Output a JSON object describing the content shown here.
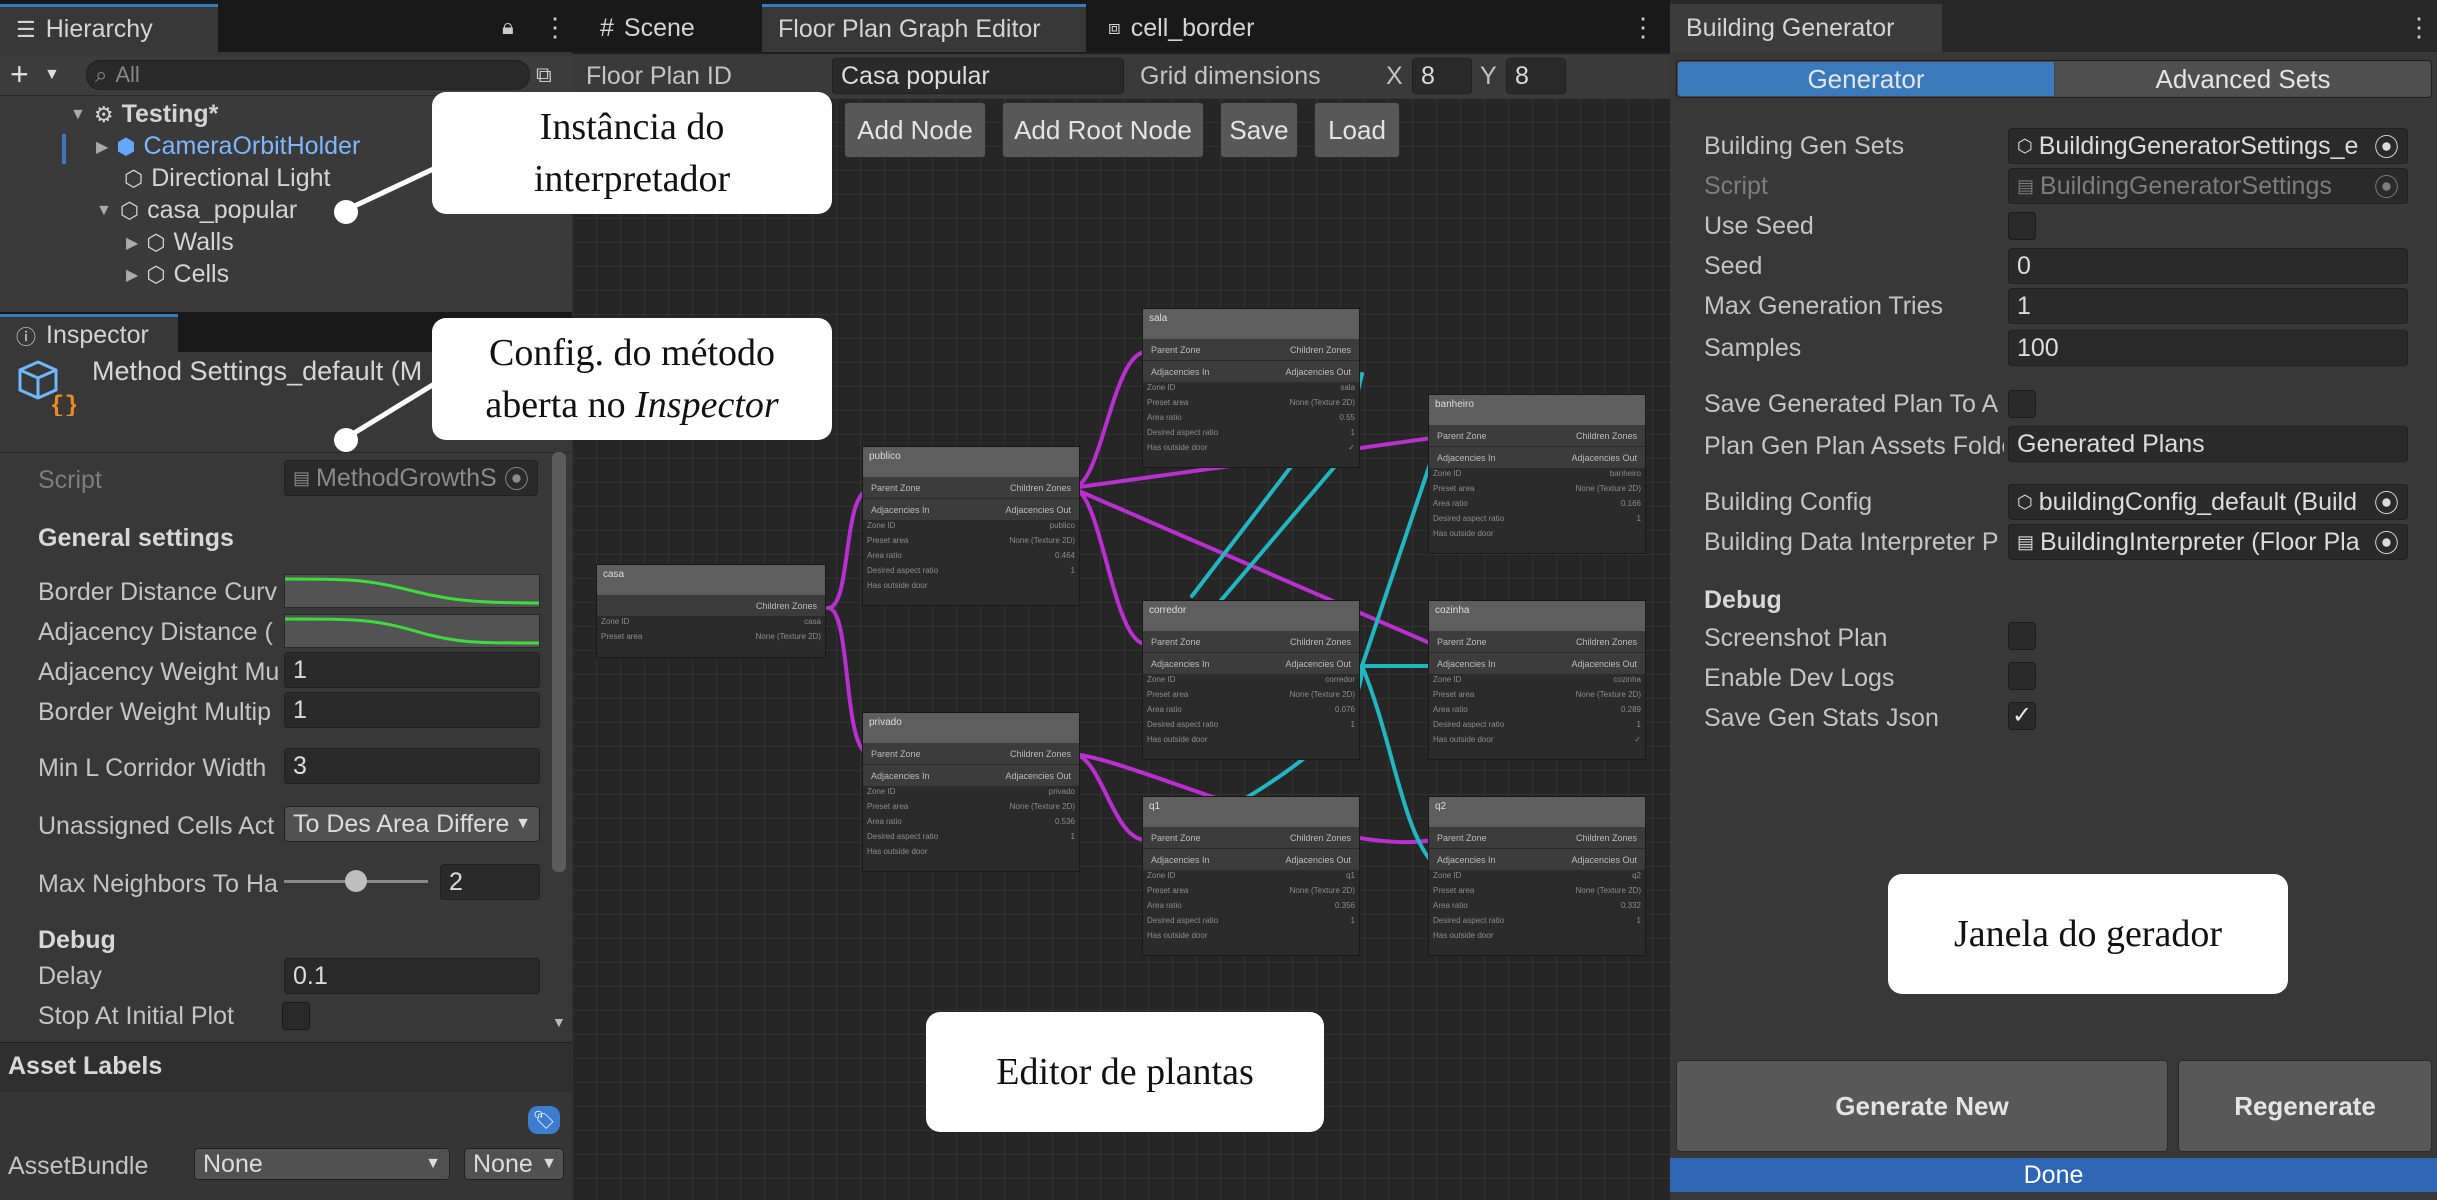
{
  "hierarchy": {
    "tab_label": "Hierarchy",
    "search_placeholder": "All",
    "items": [
      {
        "label": "Testing*"
      },
      {
        "label": "CameraOrbitHolder"
      },
      {
        "label": "Directional Light"
      },
      {
        "label": "casa_popular"
      },
      {
        "label": "Walls"
      },
      {
        "label": "Cells"
      }
    ]
  },
  "inspector": {
    "tab_label": "Inspector",
    "object_title": "Method Settings_default (M",
    "script_label": "Script",
    "script_value": "MethodGrowthS",
    "general_header": "General settings",
    "border_curve_label": "Border Distance Curv",
    "adjacency_curve_label": "Adjacency Distance (",
    "adj_weight_label": "Adjacency Weight Mu",
    "adj_weight_value": "1",
    "border_weight_label": "Border Weight Multip",
    "border_weight_value": "1",
    "min_corridor_label": "Min L Corridor Width",
    "min_corridor_value": "3",
    "unassigned_label": "Unassigned Cells Act",
    "unassigned_value": "To Des Area Differe",
    "max_neighbors_label": "Max Neighbors To Ha",
    "max_neighbors_value": "2",
    "max_neighbors_fraction": 0.5,
    "debug_header": "Debug",
    "delay_label": "Delay",
    "delay_value": "0.1",
    "stop_label": "Stop At Initial Plot",
    "asset_labels": "Asset Labels",
    "assetbundle_label": "AssetBundle",
    "assetbundle_value": "None",
    "assetbundle_variant": "None"
  },
  "center": {
    "tabs": [
      "Scene",
      "Floor Plan Graph Editor",
      "cell_border"
    ],
    "floor_plan_id_label": "Floor Plan ID",
    "floor_plan_id_value": "Casa popular",
    "grid_label": "Grid dimensions",
    "x_label": "X",
    "x_value": "8",
    "y_label": "Y",
    "y_value": "8",
    "buttons": [
      "Add Node",
      "Add Root Node",
      "Save",
      "Load"
    ]
  },
  "graph": {
    "nodes": [
      {
        "title": "casa",
        "zone_id": "casa",
        "kind": "root"
      },
      {
        "title": "publico",
        "zone_id": "publico",
        "area": "0.464",
        "aspect": "1"
      },
      {
        "title": "privado",
        "zone_id": "privado",
        "area": "0.536",
        "aspect": "1"
      },
      {
        "title": "sala",
        "zone_id": "sala",
        "area": "0.55",
        "aspect": "1"
      },
      {
        "title": "corredor",
        "zone_id": "corredor",
        "area": "0.076",
        "aspect": "1"
      },
      {
        "title": "q1",
        "zone_id": "q1",
        "area": "0.356",
        "aspect": "1"
      },
      {
        "title": "banheiro",
        "zone_id": "banheiro",
        "area": "0.166",
        "aspect": "1"
      },
      {
        "title": "cozinha",
        "zone_id": "cozinha",
        "area": "0.289",
        "aspect": "1"
      },
      {
        "title": "q2",
        "zone_id": "q2",
        "area": "0.332",
        "aspect": "1"
      }
    ],
    "labels": {
      "parent": "Parent Zone",
      "children": "Children Zones",
      "adj_in": "Adjacencies In",
      "adj_out": "Adjacencies Out",
      "zone_id": "Zone ID",
      "preset": "Preset area",
      "preset_value": "None (Texture 2D)",
      "area_ratio": "Area ratio",
      "aspect": "Desired aspect ratio",
      "outside": "Has outside door"
    }
  },
  "generator": {
    "window_tab": "Building Generator",
    "tabs": [
      "Generator",
      "Advanced Sets"
    ],
    "gen_sets_label": "Building Gen Sets",
    "gen_sets_value": "BuildingGeneratorSettings_e",
    "script_label": "Script",
    "script_value": "BuildingGeneratorSettings",
    "use_seed_label": "Use Seed",
    "seed_label": "Seed",
    "seed_value": "0",
    "max_tries_label": "Max Generation Tries",
    "max_tries_value": "1",
    "samples_label": "Samples",
    "samples_value": "100",
    "save_plan_label": "Save Generated Plan To A",
    "folder_label": "Plan Gen Plan Assets Folde",
    "folder_value": "Generated Plans",
    "config_label": "Building Config",
    "config_value": "buildingConfig_default (Build",
    "interpreter_label": "Building Data Interpreter P",
    "interpreter_value": "BuildingInterpreter (Floor Pla",
    "debug_header": "Debug",
    "screenshot_label": "Screenshot Plan",
    "dev_logs_label": "Enable Dev Logs",
    "stats_label": "Save Gen Stats Json",
    "generate_button": "Generate New",
    "regenerate_button": "Regenerate",
    "status": "Done"
  },
  "callouts": {
    "interpreter_l1": "Instância do",
    "interpreter_l2": "interpretador",
    "config_l1": "Config. do método",
    "config_l2_a": "aberta no ",
    "config_l2_b": "Inspector",
    "editor": "Editor de plantas",
    "generator": "Janela do gerador"
  },
  "colors": {
    "accent": "#3a79bb",
    "edge_magenta": "#b92fd0",
    "edge_cyan": "#22b6c0",
    "curve_green": "#3ddc3d",
    "status_bar": "#2f66b3"
  }
}
